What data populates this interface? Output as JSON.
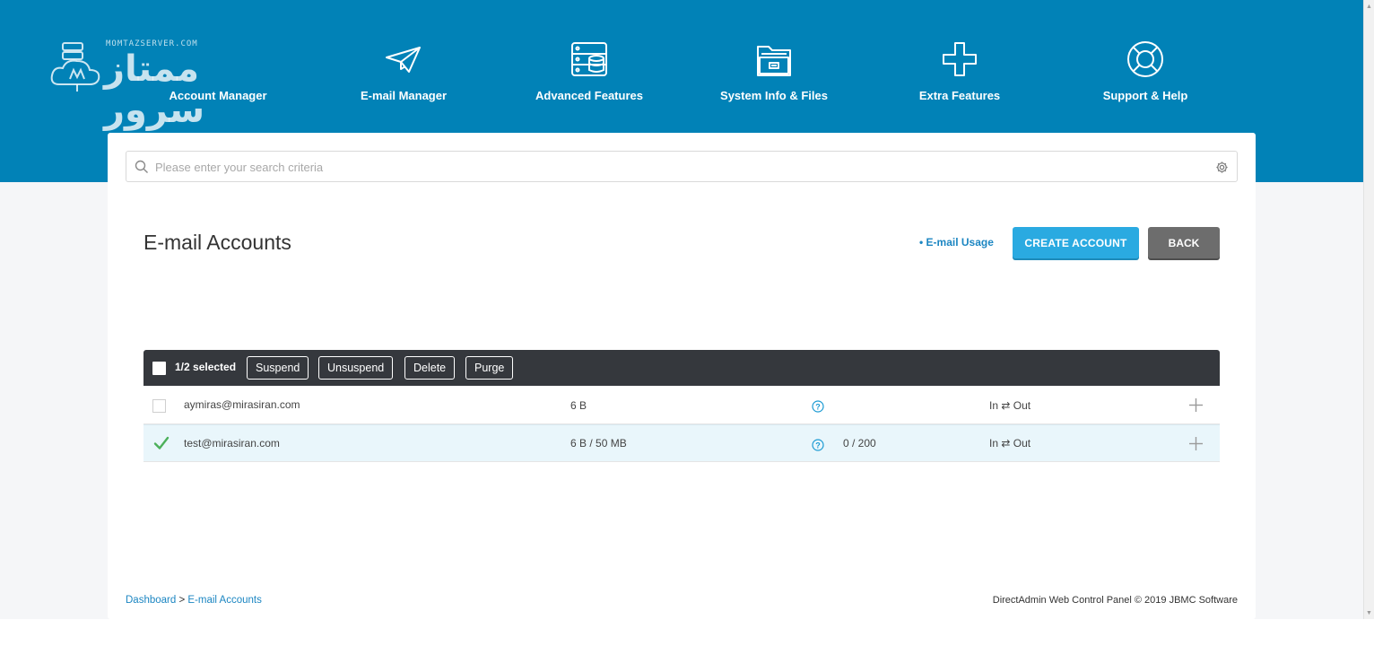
{
  "colors": {
    "header_bg": "#0182b7",
    "primary_button": "#2aaae1",
    "secondary_button": "#6d6d6d",
    "toolbar_bg": "#35383d",
    "selected_row_bg": "#e9f6fb",
    "link": "#1c86c2",
    "check_green": "#4cb05a"
  },
  "logo": {
    "small_text": "MOMTAZSERVER.COM",
    "main_text": "ممتاز سرور"
  },
  "nav": {
    "items": [
      {
        "label": "Account Manager",
        "icon": "user-gear-icon"
      },
      {
        "label": "E-mail Manager",
        "icon": "paper-plane-icon"
      },
      {
        "label": "Advanced Features",
        "icon": "server-database-icon"
      },
      {
        "label": "System Info & Files",
        "icon": "file-drawer-icon"
      },
      {
        "label": "Extra Features",
        "icon": "plus-icon"
      },
      {
        "label": "Support & Help",
        "icon": "lifebuoy-icon"
      }
    ]
  },
  "search": {
    "placeholder": "Please enter your search criteria",
    "value": ""
  },
  "page": {
    "title": "E-mail Accounts",
    "usage_link": "• E-mail Usage",
    "create_label": "CREATE ACCOUNT",
    "back_label": "BACK"
  },
  "toolbar": {
    "selected_text": "1/2 selected",
    "actions": [
      "Suspend",
      "Unsuspend",
      "Delete",
      "Purge"
    ]
  },
  "table": {
    "rows": [
      {
        "email": "aymiras@mirasiran.com",
        "usage": "6 B",
        "sends": "",
        "direction": "In ⇄ Out",
        "selected": false
      },
      {
        "email": "test@mirasiran.com",
        "usage": "6 B / 50 MB",
        "sends": "0 / 200",
        "direction": "In ⇄ Out",
        "selected": true
      }
    ]
  },
  "breadcrumb": {
    "home": "Dashboard",
    "separator": " > ",
    "current": "E-mail Accounts"
  },
  "footer": {
    "text": "DirectAdmin Web Control Panel © 2019 JBMC Software"
  }
}
